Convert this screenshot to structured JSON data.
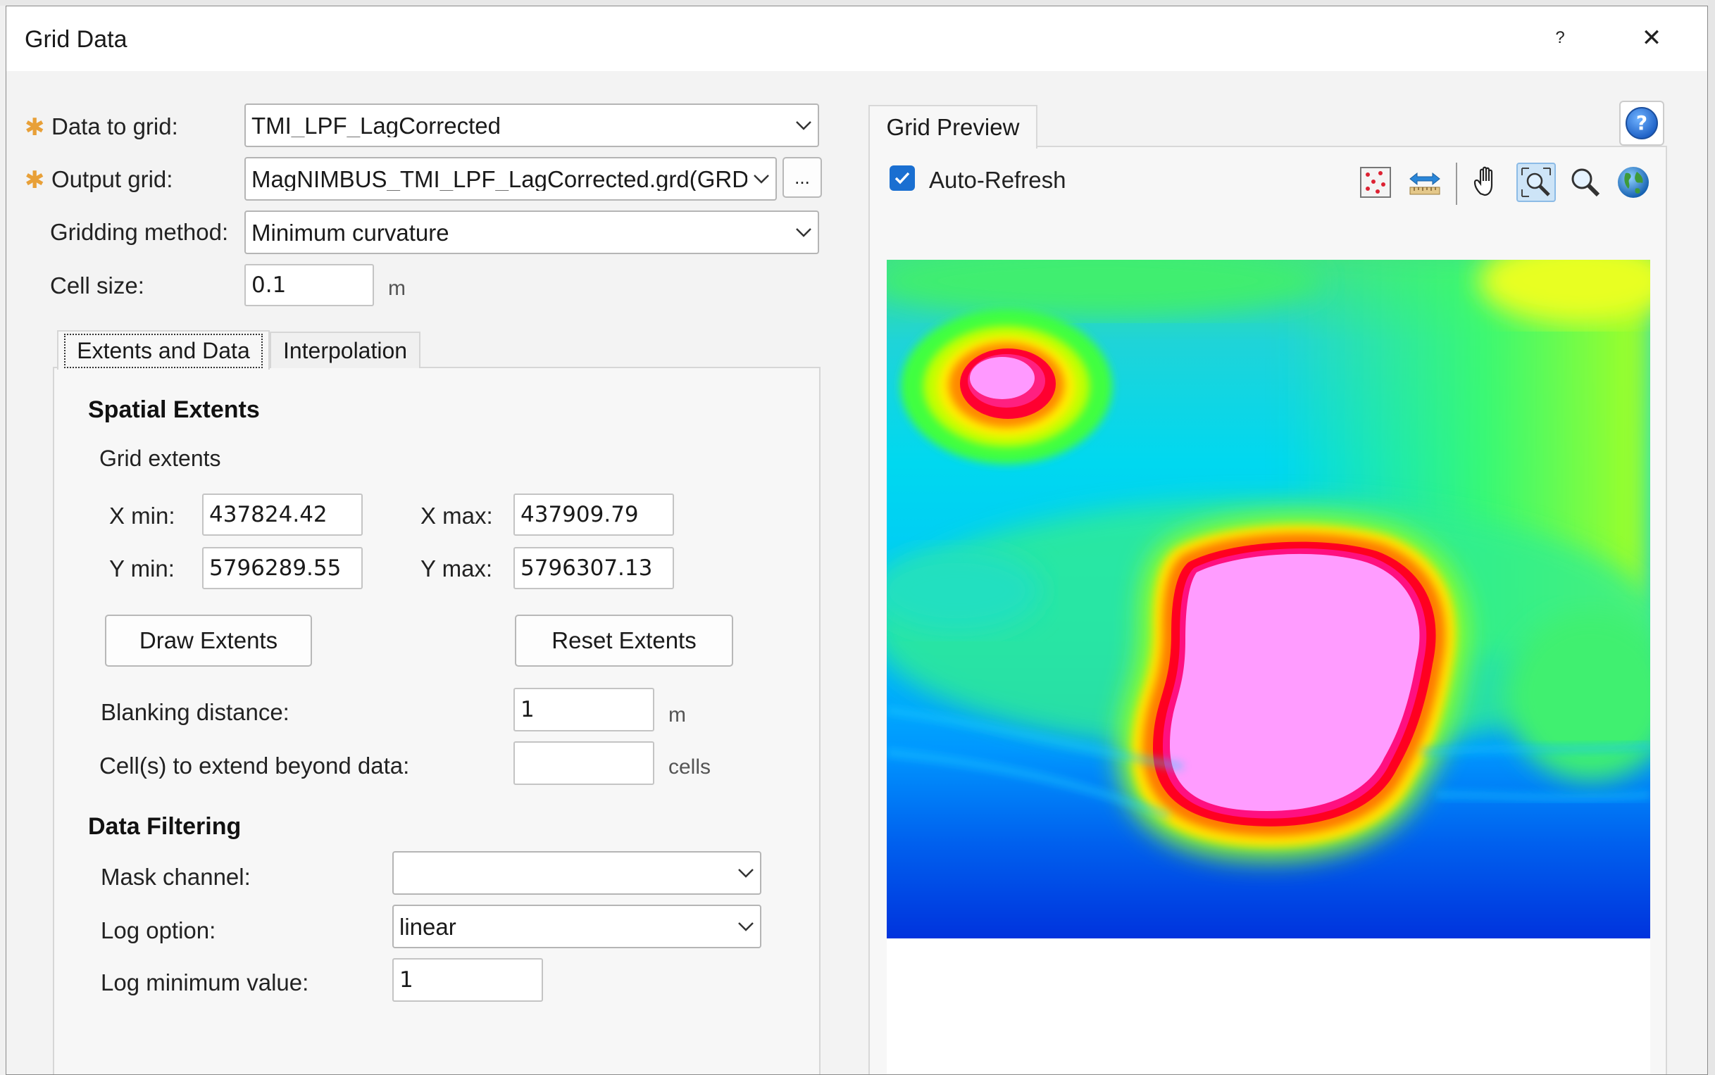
{
  "window": {
    "title": "Grid Data",
    "help_glyph": "?",
    "close_glyph": "✕"
  },
  "form": {
    "data_to_grid": {
      "label": "Data to grid:",
      "value": "TMI_LPF_LagCorrected",
      "required_mark": "✱"
    },
    "output_grid": {
      "label": "Output grid:",
      "value": "MagNIMBUS_TMI_LPF_LagCorrected.grd(GRD)",
      "browse_label": "...",
      "required_mark": "✱"
    },
    "gridding_method": {
      "label": "Gridding method:",
      "value": "Minimum curvature"
    },
    "cell_size": {
      "label": "Cell size:",
      "value": "0.1",
      "unit": "m"
    }
  },
  "tabs": [
    {
      "label": "Extents and Data",
      "active": true
    },
    {
      "label": "Interpolation",
      "active": false
    }
  ],
  "spatial_extents": {
    "title": "Spatial Extents",
    "subtitle": "Grid extents",
    "x_min": {
      "label": "X min:",
      "value": "437824.42"
    },
    "x_max": {
      "label": "X max:",
      "value": "437909.79"
    },
    "y_min": {
      "label": "Y min:",
      "value": "5796289.55"
    },
    "y_max": {
      "label": "Y max:",
      "value": "5796307.13"
    },
    "draw_extents_label": "Draw Extents",
    "reset_extents_label": "Reset Extents",
    "blanking_distance": {
      "label": "Blanking distance:",
      "value": "1",
      "unit": "m"
    },
    "cells_extend": {
      "label": "Cell(s) to extend beyond data:",
      "value": "",
      "unit": "cells"
    }
  },
  "data_filtering": {
    "title": "Data Filtering",
    "mask_channel": {
      "label": "Mask channel:",
      "value": ""
    },
    "log_option": {
      "label": "Log option:",
      "value": "linear"
    },
    "log_minimum": {
      "label": "Log minimum value:",
      "value": "1"
    }
  },
  "preview": {
    "tab_label": "Grid Preview",
    "auto_refresh_label": "Auto-Refresh",
    "auto_refresh_checked": true,
    "tools": [
      "scatter-points-icon",
      "measure-icon",
      "pan-hand-icon",
      "zoom-extent-icon",
      "zoom-icon",
      "globe-icon"
    ],
    "active_tool": "zoom-extent-icon"
  },
  "colors": {
    "accent": "#1a6fd1",
    "required": "#e8a038"
  }
}
